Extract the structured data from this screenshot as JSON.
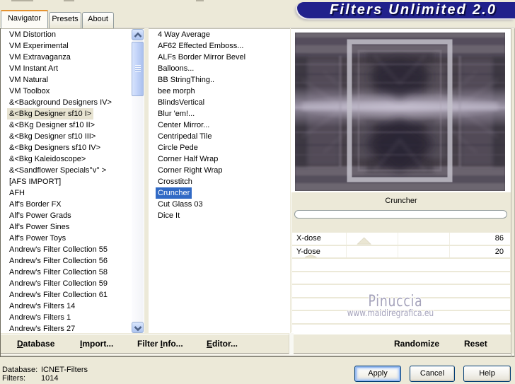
{
  "window": {
    "banner_title": "Filters Unlimited 2.0"
  },
  "tabs": [
    {
      "label": "Navigator",
      "active": true
    },
    {
      "label": "Presets",
      "active": false
    },
    {
      "label": "About",
      "active": false
    }
  ],
  "category_list": {
    "items": [
      {
        "label": "VM Distortion"
      },
      {
        "label": "VM Experimental"
      },
      {
        "label": "VM Extravaganza"
      },
      {
        "label": "VM Instant Art"
      },
      {
        "label": "VM Natural"
      },
      {
        "label": "VM Toolbox"
      },
      {
        "label": "&<Background Designers IV>"
      },
      {
        "label": "&<Bkg Designer sf10 I>",
        "selected": true
      },
      {
        "label": "&<BKg Designer sf10 II>"
      },
      {
        "label": "&<Bkg Designer sf10 III>"
      },
      {
        "label": "&<Bkg Designers sf10 IV>"
      },
      {
        "label": "&<Bkg Kaleidoscope>"
      },
      {
        "label": "&<Sandflower Specials°v° >"
      },
      {
        "label": "[AFS IMPORT]"
      },
      {
        "label": "AFH"
      },
      {
        "label": "Alf's Border FX"
      },
      {
        "label": "Alf's Power Grads"
      },
      {
        "label": "Alf's Power Sines"
      },
      {
        "label": "Alf's Power Toys"
      },
      {
        "label": "Andrew's Filter Collection 55"
      },
      {
        "label": "Andrew's Filter Collection 56"
      },
      {
        "label": "Andrew's Filter Collection 58"
      },
      {
        "label": "Andrew's Filter Collection 59"
      },
      {
        "label": "Andrew's Filter Collection 61"
      },
      {
        "label": "Andrew's Filters 14"
      },
      {
        "label": "Andrew's Filters 1"
      },
      {
        "label": "Andrew's Filters 27"
      }
    ]
  },
  "filter_list": {
    "items": [
      {
        "label": "4 Way Average"
      },
      {
        "label": "AF62 Effected Emboss..."
      },
      {
        "label": "ALFs Border Mirror Bevel"
      },
      {
        "label": "Balloons..."
      },
      {
        "label": "BB StringThing.."
      },
      {
        "label": "bee morph"
      },
      {
        "label": "BlindsVertical"
      },
      {
        "label": "Blur 'em!..."
      },
      {
        "label": "Center Mirror..."
      },
      {
        "label": "Centripedal Tile"
      },
      {
        "label": "Circle Pede"
      },
      {
        "label": "Corner Half Wrap"
      },
      {
        "label": "Corner Right Wrap"
      },
      {
        "label": "Crosstitch"
      },
      {
        "label": "Cruncher",
        "selected": true
      },
      {
        "label": "Cut Glass 03"
      },
      {
        "label": "Dice It"
      }
    ]
  },
  "preview": {
    "filter_name": "Cruncher",
    "progress_percent": 0
  },
  "parameters": {
    "slider_min": 0,
    "slider_max": 255,
    "rows": [
      {
        "name": "X-dose",
        "value": 86
      },
      {
        "name": "Y-dose",
        "value": 20
      }
    ],
    "empty_row_count": 6
  },
  "watermark": {
    "name": "Pinuccia",
    "url_text": "www.maidiregrafica.eu"
  },
  "icons": [
    "chevron-up-icon",
    "chevron-down-icon"
  ],
  "actions_left": [
    {
      "pre": "",
      "key": "D",
      "post": "atabase"
    },
    {
      "pre": "",
      "key": "I",
      "post": "mport..."
    },
    {
      "pre": "Filter ",
      "key": "I",
      "post": "nfo..."
    },
    {
      "pre": "",
      "key": "E",
      "post": "ditor..."
    }
  ],
  "actions_right": [
    {
      "label": "Randomize"
    },
    {
      "label": "Reset"
    }
  ],
  "status": {
    "database_label": "Database:",
    "database_value": "ICNET-Filters",
    "filters_label": "Filters:",
    "filters_value": "1014"
  },
  "buttons": [
    {
      "label": "Apply",
      "focused": true
    },
    {
      "label": "Cancel",
      "focused": false
    },
    {
      "label": "Help",
      "focused": false
    }
  ],
  "colors": {
    "dialog_bg": "#ECE9D8",
    "banner_bg": "#21218C",
    "selection_blue": "#316AC5",
    "selection_gray": "#E7E3D1",
    "button_border": "#003C74"
  }
}
